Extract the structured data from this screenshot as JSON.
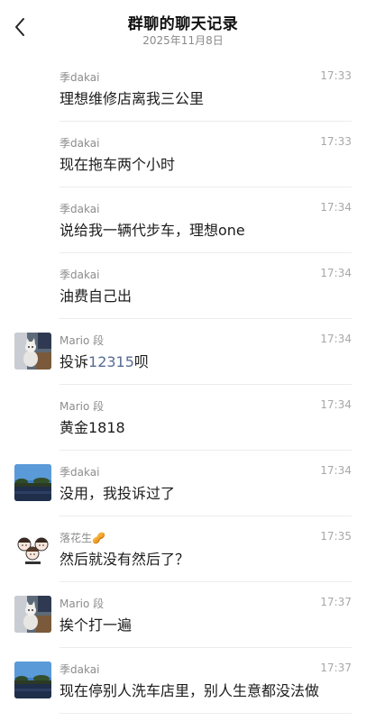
{
  "header": {
    "title": "群聊的聊天记录",
    "date": "2025年11月8日"
  },
  "messages": [
    {
      "sender": "季dakai",
      "time": "17:33",
      "text": "理想维修店离我三公里",
      "avatar": ""
    },
    {
      "sender": "季dakai",
      "time": "17:33",
      "text": "现在拖车两个小时",
      "avatar": ""
    },
    {
      "sender": "季dakai",
      "time": "17:34",
      "text": "说给我一辆代步车，理想one",
      "avatar": ""
    },
    {
      "sender": "季dakai",
      "time": "17:34",
      "text": "油费自己出",
      "avatar": ""
    },
    {
      "sender": "Mario 段",
      "time": "17:34",
      "text_before": "投诉",
      "text_link": "12315",
      "text_after": "呗",
      "avatar": "cat-photo"
    },
    {
      "sender": "Mario 段",
      "time": "17:34",
      "text": "黄金1818",
      "avatar": ""
    },
    {
      "sender": "季dakai",
      "time": "17:34",
      "text": "没用，我投诉过了",
      "avatar": "landscape-photo"
    },
    {
      "sender": "落花生🥜",
      "time": "17:35",
      "text": "然后就没有然后了？",
      "avatar": "cartoon-group"
    },
    {
      "sender": "Mario 段",
      "time": "17:37",
      "text": "挨个打一遍",
      "avatar": "cat-photo"
    },
    {
      "sender": "季dakai",
      "time": "17:37",
      "text": "现在停别人洗车店里，别人生意都没法做",
      "avatar": "landscape-photo"
    }
  ]
}
